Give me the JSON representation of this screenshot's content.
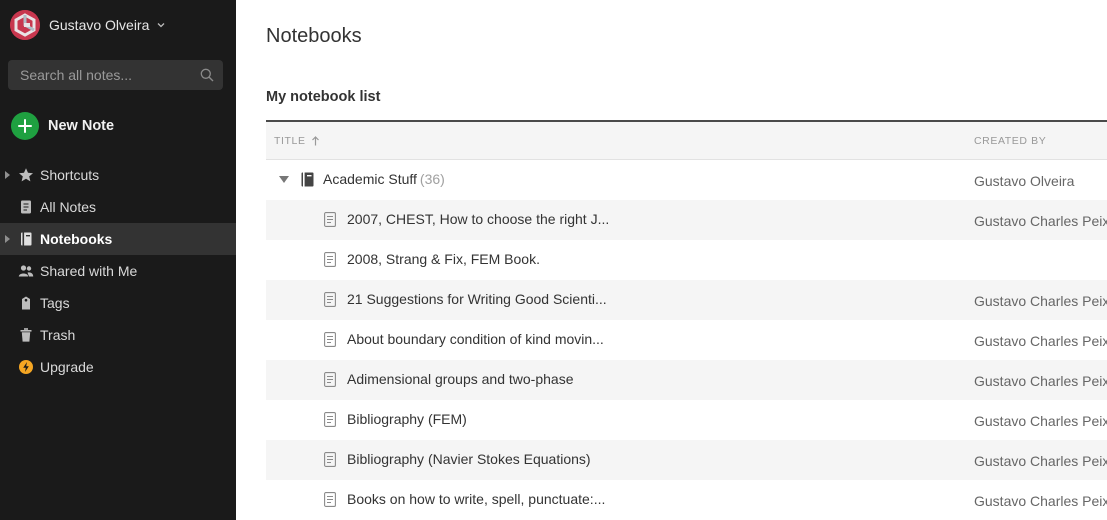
{
  "account": {
    "name": "Gustavo Olveira"
  },
  "search": {
    "placeholder": "Search all notes..."
  },
  "new_note": {
    "label": "New Note"
  },
  "nav": [
    {
      "label": "Shortcuts",
      "icon": "star-icon",
      "expandable": true,
      "active": false
    },
    {
      "label": "All Notes",
      "icon": "note-icon",
      "expandable": false,
      "active": false
    },
    {
      "label": "Notebooks",
      "icon": "notebook-icon",
      "expandable": true,
      "active": true
    },
    {
      "label": "Shared with Me",
      "icon": "people-icon",
      "expandable": false,
      "active": false
    },
    {
      "label": "Tags",
      "icon": "tag-icon",
      "expandable": false,
      "active": false
    },
    {
      "label": "Trash",
      "icon": "trash-icon",
      "expandable": false,
      "active": false
    },
    {
      "label": "Upgrade",
      "icon": "lightning-icon",
      "expandable": false,
      "active": false
    }
  ],
  "main": {
    "page_title": "Notebooks",
    "section_title": "My notebook list",
    "columns": {
      "title": "TITLE",
      "created_by": "CREATED BY"
    },
    "notebook": {
      "name": "Academic Stuff",
      "count": "(36)",
      "created_by": "Gustavo Olveira"
    },
    "notes": [
      {
        "title": "2007, CHEST, How to choose the right J...",
        "created_by": "Gustavo Charles Peix"
      },
      {
        "title": "2008, Strang & Fix, FEM Book.",
        "created_by": ""
      },
      {
        "title": "21 Suggestions for Writing Good Scienti...",
        "created_by": "Gustavo Charles Peix"
      },
      {
        "title": "About boundary condition of kind movin...",
        "created_by": "Gustavo Charles Peix"
      },
      {
        "title": "Adimensional groups and two-phase",
        "created_by": "Gustavo Charles Peix"
      },
      {
        "title": "Bibliography (FEM)",
        "created_by": "Gustavo Charles Peix"
      },
      {
        "title": "Bibliography (Navier Stokes Equations)",
        "created_by": "Gustavo Charles Peix"
      },
      {
        "title": "Books on how to write, spell, punctuate:...",
        "created_by": "Gustavo Charles Peix"
      }
    ]
  },
  "colors": {
    "sidebar_bg": "#1a1a1a",
    "sidebar_active": "#333333",
    "new_note_green": "#1fa040",
    "avatar": "#c8374f",
    "upgrade_yellow": "#f5a623"
  }
}
